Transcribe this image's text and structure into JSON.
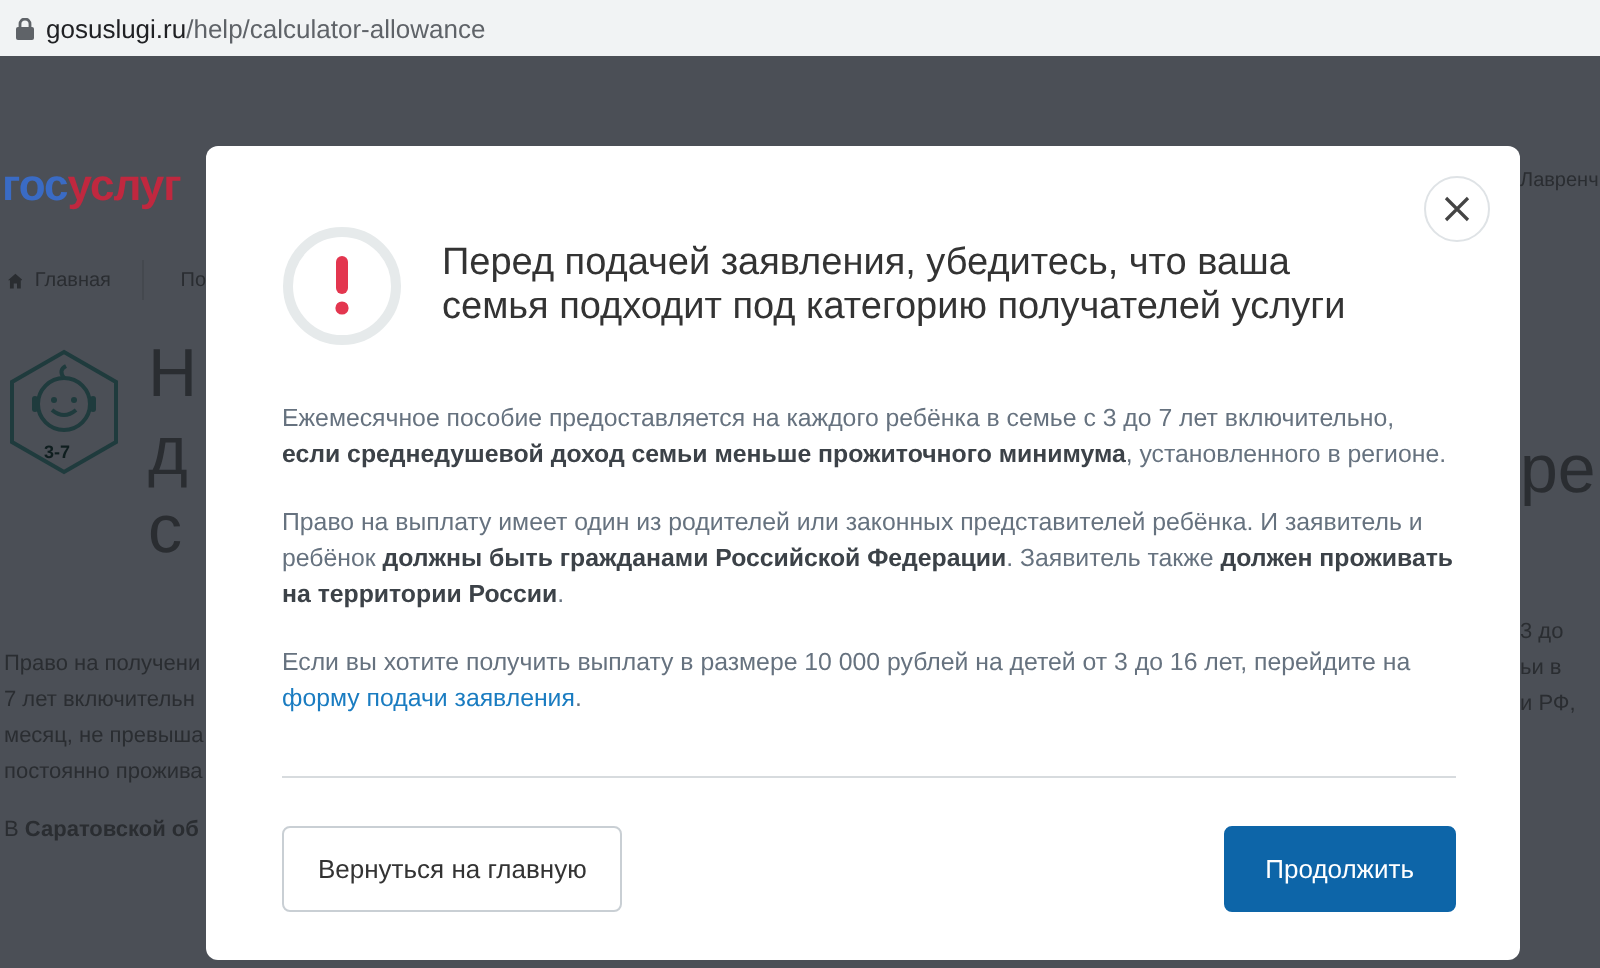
{
  "address_bar": {
    "host": "gosuslugi.ru",
    "path": "/help/calculator-allowance"
  },
  "background_page": {
    "logo": [
      {
        "text": "гос",
        "color": "#3a6bc4"
      },
      {
        "text": "услуг",
        "color": "#c0283f"
      }
    ],
    "user_name": "Лавренч",
    "breadcrumbs": [
      {
        "label": "Главная"
      },
      {
        "label": "По"
      }
    ],
    "icon_caption": "3-7",
    "heading_left": [
      "Н",
      "д",
      "с"
    ],
    "heading_right": "ре",
    "paragraph_left": [
      "Право на получени",
      "7 лет включительн",
      "месяц, не превыша",
      "постоянно прожива"
    ],
    "paragraph_right": [
      "3 до",
      "ьи в",
      "и РФ,"
    ],
    "region_note": "В **Саратовской об**"
  },
  "dialog": {
    "title": "Перед подачей заявления, убедитесь, что ваша семья подходит под категорию получателей услуги",
    "paragraphs": [
      {
        "text": "Ежемесячное пособие предоставляется на каждого ребёнка в семье с 3 до 7 лет включительно, **если среднедушевой доход семьи меньше прожиточного минимума**, установленного в регионе."
      },
      {
        "text": "Право на выплату имеет один из родителей или законных представителей ребёнка. И заявитель и ребёнок **должны быть гражданами Российской Федерации**. Заявитель также **должен проживать на территории России**."
      },
      {
        "text": "Если вы хотите получить выплату в размере 10 000 рублей на детей от 3 до 16 лет, перейдите на",
        "link": "форму подачи заявления",
        "after": "."
      }
    ],
    "buttons": [
      {
        "label": "Вернуться на главную",
        "kind": "secondary"
      },
      {
        "label": "Продолжить",
        "kind": "primary"
      }
    ]
  }
}
